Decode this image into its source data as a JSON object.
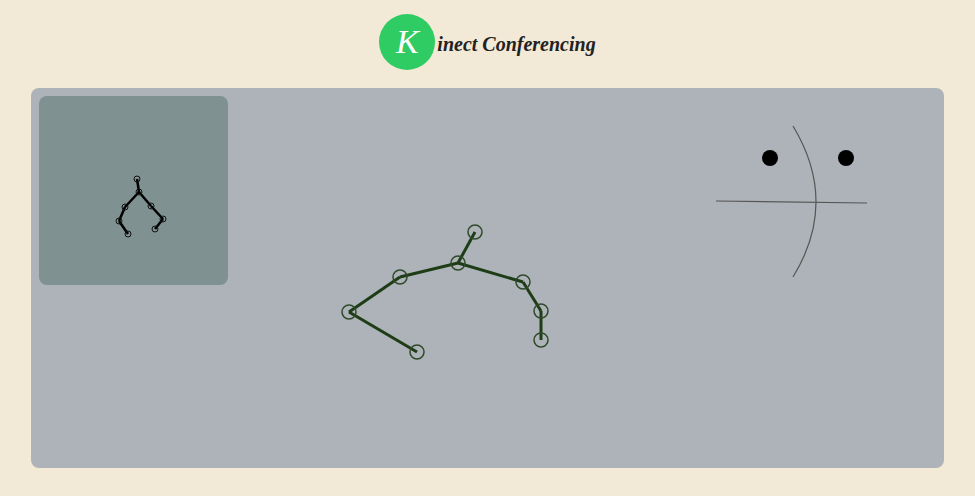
{
  "header": {
    "logo_letter": "K",
    "title": "inect Conferencing"
  }
}
